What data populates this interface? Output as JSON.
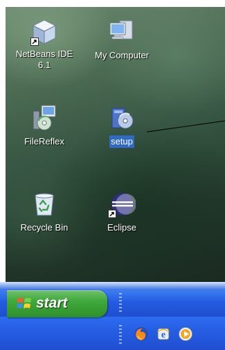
{
  "desktop": {
    "icons": [
      {
        "label": "NetBeans IDE\n6.1",
        "icon": "netbeans-cube-icon"
      },
      {
        "label": "My Computer",
        "icon": "computer-icon"
      },
      {
        "label": "FileReflex",
        "icon": "filereflex-icon"
      },
      {
        "label": "setup",
        "icon": "setup-installer-icon",
        "selected": true
      },
      {
        "label": "Recycle Bin",
        "icon": "recycle-bin-icon"
      },
      {
        "label": "Eclipse",
        "icon": "eclipse-icon"
      }
    ]
  },
  "taskbar": {
    "start_label": "start",
    "quick_launch": [
      "firefox-icon",
      "internet-explorer-icon",
      "media-player-icon"
    ]
  },
  "colors": {
    "taskbar_blue": "#255be0",
    "start_green": "#3fa83b",
    "selection_blue": "#316ac5"
  }
}
